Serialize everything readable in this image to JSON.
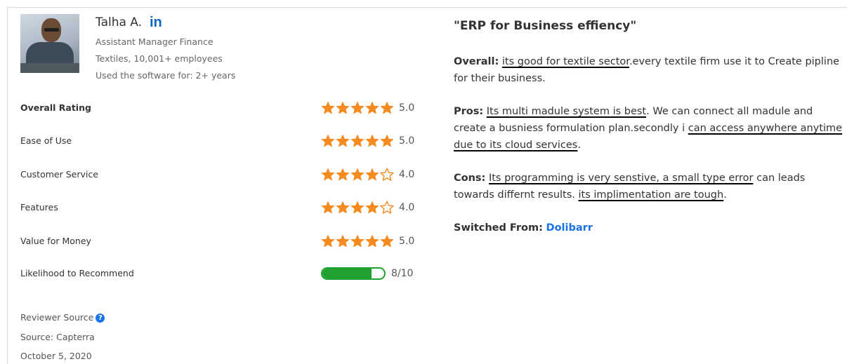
{
  "reviewer": {
    "name": "Talha A.",
    "linkedin": "in",
    "role": "Assistant Manager Finance",
    "company": "Textiles, 10,001+ employees",
    "usage": "Used the software for: 2+ years"
  },
  "ratings": [
    {
      "label": "Overall Rating",
      "value": "5.0",
      "stars": 5
    },
    {
      "label": "Ease of Use",
      "value": "5.0",
      "stars": 5
    },
    {
      "label": "Customer Service",
      "value": "4.0",
      "stars": 4
    },
    {
      "label": "Features",
      "value": "4.0",
      "stars": 4
    },
    {
      "label": "Value for Money",
      "value": "5.0",
      "stars": 5
    }
  ],
  "recommend": {
    "label": "Likelihood to Recommend",
    "value": "8/10",
    "score": 8,
    "max": 10
  },
  "source": {
    "reviewer_source": "Reviewer Source",
    "source_text": "Source: Capterra",
    "date": "October 5, 2020"
  },
  "review": {
    "title": "\"ERP for Business effiency\"",
    "overall_label": "Overall:",
    "overall_u": "its good for textile sector",
    "overall_rest": ".every textile firm use it to Create pipline for their business.",
    "pros_label": "Pros:",
    "pros_a": "Its multi madule system is best",
    "pros_b": ". We can connect all madule and create a busniess formulation plan.secondly i ",
    "pros_c": "can access anywhere anytime due to its cloud services",
    "pros_d": ".",
    "cons_label": "Cons:",
    "cons_a": "Its programming is very senstive, a small type error",
    "cons_b": " can leads towards differnt results. ",
    "cons_c": "its implimentation are tough",
    "cons_d": ".",
    "switched_label": "Switched From:",
    "switched_value": "Dolibarr"
  },
  "colors": {
    "star": "#f58a1f",
    "bar": "#1fa22f",
    "link": "#1a73e8",
    "linkedin": "#0a66c2"
  }
}
